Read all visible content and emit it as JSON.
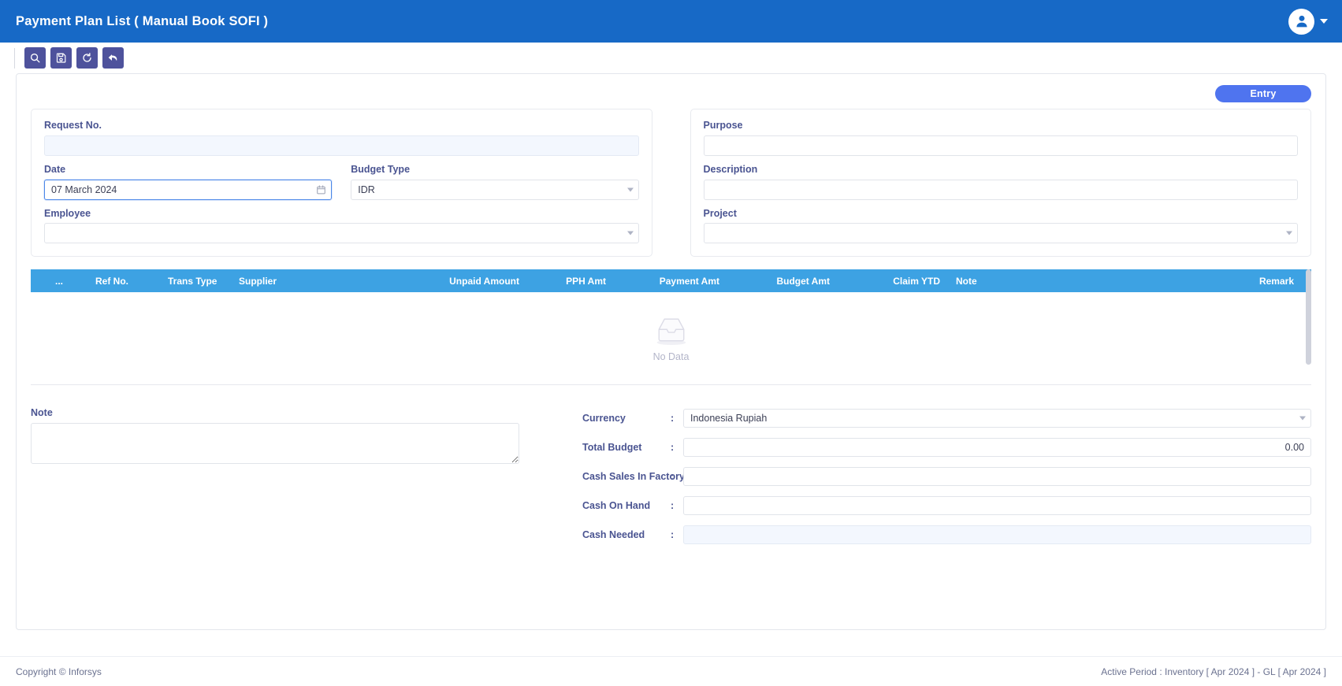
{
  "header": {
    "title": "Payment Plan List ( Manual Book SOFI )",
    "avatar_icon": "user-icon",
    "caret_icon": "chevron-down-icon"
  },
  "toolbar": {
    "buttons": [
      {
        "name": "search-button",
        "icon": "search-icon",
        "label": "Search"
      },
      {
        "name": "save-button",
        "icon": "save-floppy-icon",
        "label": "Save"
      },
      {
        "name": "reset-button",
        "icon": "refresh-ccw-icon",
        "label": "Reset"
      },
      {
        "name": "back-button",
        "icon": "arrow-back-icon",
        "label": "Back"
      }
    ]
  },
  "actions": {
    "entry_label": "Entry"
  },
  "form": {
    "left": {
      "request_no": {
        "label": "Request No.",
        "value": "",
        "placeholder": ""
      },
      "date": {
        "label": "Date",
        "value": "07 March 2024",
        "placeholder": "",
        "icon": "calendar-icon"
      },
      "budget_type": {
        "label": "Budget Type",
        "value": "IDR",
        "placeholder": "",
        "icon": "chevron-down-icon"
      },
      "employee": {
        "label": "Employee",
        "value": "",
        "placeholder": "",
        "icon": "chevron-down-icon"
      }
    },
    "right": {
      "purpose": {
        "label": "Purpose",
        "value": "",
        "placeholder": ""
      },
      "description": {
        "label": "Description",
        "value": "",
        "placeholder": ""
      },
      "project": {
        "label": "Project",
        "value": "",
        "placeholder": "",
        "icon": "chevron-down-icon"
      }
    }
  },
  "table": {
    "columns": [
      {
        "key": "select",
        "label": "..."
      },
      {
        "key": "ref_no",
        "label": "Ref No."
      },
      {
        "key": "trans_type",
        "label": "Trans Type"
      },
      {
        "key": "supplier",
        "label": "Supplier"
      },
      {
        "key": "unpaid_amount",
        "label": "Unpaid Amount"
      },
      {
        "key": "pph_amt",
        "label": "PPH Amt"
      },
      {
        "key": "payment_amt",
        "label": "Payment Amt"
      },
      {
        "key": "budget_amt",
        "label": "Budget Amt"
      },
      {
        "key": "claim_ytd",
        "label": "Claim YTD"
      },
      {
        "key": "note",
        "label": "Note"
      },
      {
        "key": "remark",
        "label": "Remark"
      }
    ],
    "rows": [],
    "empty_label": "No Data",
    "empty_icon": "empty-inbox-icon"
  },
  "note": {
    "label": "Note",
    "value": "",
    "placeholder": ""
  },
  "summary": {
    "rows": [
      {
        "name": "currency",
        "label": "Currency",
        "separator": ":",
        "value": "Indonesia Rupiah",
        "type": "select",
        "icon": "chevron-down-icon",
        "align": "left",
        "readonly": false
      },
      {
        "name": "total-budget",
        "label": "Total Budget",
        "separator": ":",
        "value": "0.00",
        "type": "text",
        "align": "right",
        "readonly": false
      },
      {
        "name": "cash-sales-in-factory",
        "label": "Cash Sales In Factory",
        "separator": ":",
        "value": "",
        "type": "text",
        "align": "left",
        "readonly": false
      },
      {
        "name": "cash-on-hand",
        "label": "Cash On Hand",
        "separator": ":",
        "value": "",
        "type": "text",
        "align": "left",
        "readonly": false
      },
      {
        "name": "cash-needed",
        "label": "Cash Needed",
        "separator": ":",
        "value": "",
        "type": "text",
        "align": "left",
        "readonly": true
      }
    ]
  },
  "footer": {
    "copyright": "Copyright © Inforsys",
    "active_period": "Active Period  :  Inventory [ Apr 2024 ]  -  GL [ Apr 2024 ]"
  },
  "colors": {
    "header_blue": "#1769c6",
    "toolbar_button": "#4e529c",
    "entry_blue": "#4f74ef",
    "table_header_blue": "#3da2e3",
    "label_text": "#4a5491"
  }
}
